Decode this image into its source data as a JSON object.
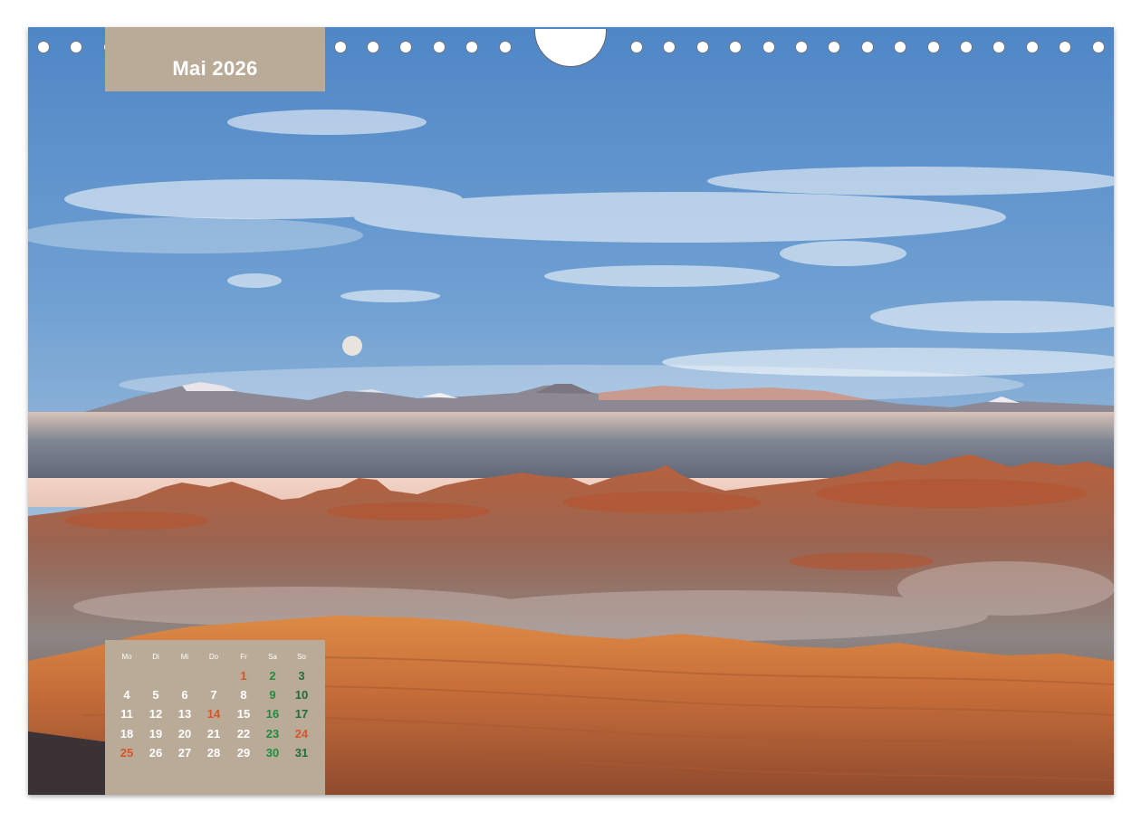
{
  "calendar": {
    "month_title": "Mai 2026",
    "weekdays": [
      "Mo",
      "Di",
      "Mi",
      "Do",
      "Fr",
      "Sa",
      "So"
    ],
    "weeks": [
      [
        "",
        "",
        "",
        "",
        "1",
        "2",
        "3"
      ],
      [
        "4",
        "5",
        "6",
        "7",
        "8",
        "9",
        "10"
      ],
      [
        "11",
        "12",
        "13",
        "14",
        "15",
        "16",
        "17"
      ],
      [
        "18",
        "19",
        "20",
        "21",
        "22",
        "23",
        "24"
      ],
      [
        "25",
        "26",
        "27",
        "28",
        "29",
        "30",
        "31"
      ]
    ],
    "holidays": [
      "1",
      "14",
      "24",
      "25"
    ]
  },
  "colors": {
    "label_bg": "#b9ab97",
    "text": "#ffffff",
    "weekend": "#1f8c41",
    "holiday": "#d8542a"
  }
}
